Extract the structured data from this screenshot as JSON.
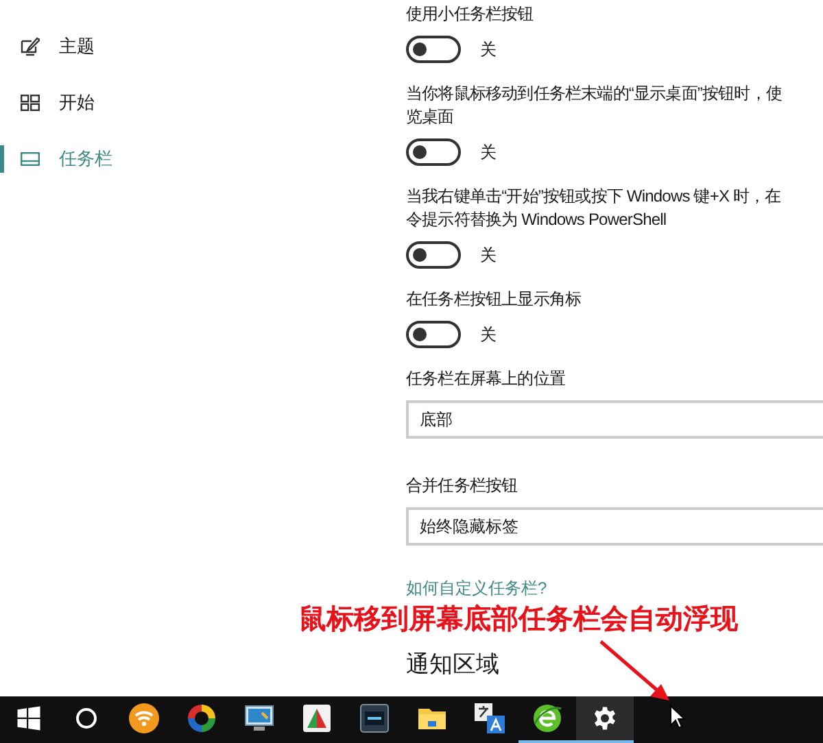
{
  "nav": [
    {
      "label": "主题",
      "kind": "theme",
      "selected": false
    },
    {
      "label": "开始",
      "kind": "start",
      "selected": false
    },
    {
      "label": "任务栏",
      "kind": "taskbar",
      "selected": true
    }
  ],
  "settings": [
    {
      "kind": "toggle",
      "lines": [
        "使用小任务栏按钮"
      ],
      "on": false,
      "state_label": "关"
    },
    {
      "kind": "toggle",
      "lines": [
        "当你将鼠标移动到任务栏末端的“显示桌面”按钮时，使",
        "览桌面"
      ],
      "on": false,
      "state_label": "关"
    },
    {
      "kind": "toggle",
      "lines": [
        "当我右键单击“开始”按钮或按下 Windows 键+X 时，在",
        "令提示符替换为 Windows PowerShell"
      ],
      "on": false,
      "state_label": "关"
    },
    {
      "kind": "toggle",
      "lines": [
        "在任务栏按钮上显示角标"
      ],
      "on": false,
      "state_label": "关"
    },
    {
      "kind": "dropdown",
      "lines": [
        "任务栏在屏幕上的位置"
      ],
      "value": "底部"
    },
    {
      "kind": "dropdown",
      "lines": [
        "合并任务栏按钮"
      ],
      "value": "始终隐藏标签"
    }
  ],
  "help_link": "如何自定义任务栏?",
  "section_heading": "通知区域",
  "annotation": "鼠标移到屏幕底部任务栏会自动浮现",
  "taskbar": [
    {
      "kind": "windows",
      "running": false,
      "active": false
    },
    {
      "kind": "search",
      "running": false,
      "active": false
    },
    {
      "kind": "wifi",
      "running": false,
      "active": false
    },
    {
      "kind": "ring",
      "running": false,
      "active": false
    },
    {
      "kind": "monitor",
      "running": false,
      "active": false
    },
    {
      "kind": "chart",
      "running": false,
      "active": false
    },
    {
      "kind": "screen",
      "running": false,
      "active": false
    },
    {
      "kind": "folder",
      "running": false,
      "active": false
    },
    {
      "kind": "translate",
      "running": false,
      "active": false
    },
    {
      "kind": "browser",
      "running": true,
      "active": false
    },
    {
      "kind": "gear",
      "running": true,
      "active": true
    }
  ]
}
